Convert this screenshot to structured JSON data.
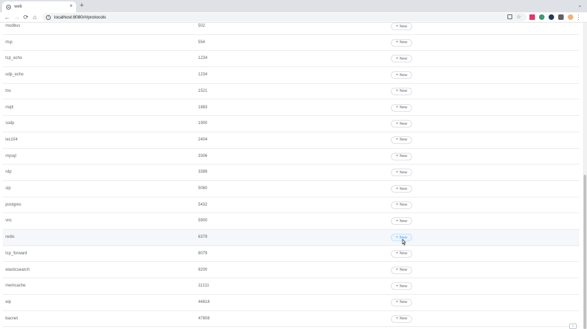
{
  "browser": {
    "tab_title": "web",
    "tab_close": "×",
    "new_tab": "+",
    "tab_menu": "⌄",
    "url": "localhost:8080/#/protocols",
    "nav": {
      "back": "←",
      "forward": "→",
      "reload": "⟳",
      "home": "⌂"
    },
    "omnibox_info_icon": "i",
    "bookmark_star": "☆",
    "menu": "⋮"
  },
  "table": {
    "new_button_label": "New",
    "new_button_icon": "+",
    "rows": [
      {
        "name": "modbus",
        "port": "502"
      },
      {
        "name": "rtsp",
        "port": "554"
      },
      {
        "name": "tcp_echo",
        "port": "1234"
      },
      {
        "name": "udp_echo",
        "port": "1234"
      },
      {
        "name": "tns",
        "port": "1521"
      },
      {
        "name": "mqtt",
        "port": "1883"
      },
      {
        "name": "ssdp",
        "port": "1900"
      },
      {
        "name": "iec104",
        "port": "2404"
      },
      {
        "name": "mysql",
        "port": "3306"
      },
      {
        "name": "rdp",
        "port": "3389"
      },
      {
        "name": "sip",
        "port": "5060"
      },
      {
        "name": "postgres",
        "port": "5432"
      },
      {
        "name": "vnc",
        "port": "5900"
      },
      {
        "name": "redis",
        "port": "6379"
      },
      {
        "name": "tcp_forward",
        "port": "8079"
      },
      {
        "name": "elasticsearch",
        "port": "9200"
      },
      {
        "name": "memcache",
        "port": "11211"
      },
      {
        "name": "eip",
        "port": "44818"
      },
      {
        "name": "bacnet",
        "port": "47808"
      }
    ],
    "hovered_row": "redis"
  },
  "colors": {
    "accent": "#409eff",
    "text": "#606266",
    "row_border": "#ececec",
    "hover_bg": "#f5f7fa"
  },
  "icons": [
    "globe-favicon-icon",
    "close-icon",
    "plus-icon",
    "back-icon",
    "forward-icon",
    "reload-icon",
    "home-icon",
    "info-icon",
    "translate-icon",
    "star-icon",
    "kebab-menu-icon",
    "mouse-cursor-icon"
  ]
}
